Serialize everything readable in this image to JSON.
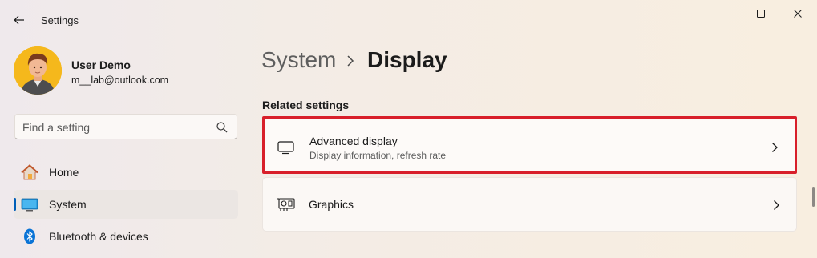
{
  "window": {
    "title": "Settings",
    "controls": {
      "minimize": "minimize-icon",
      "maximize": "maximize-icon",
      "close": "close-icon"
    }
  },
  "profile": {
    "name": "User Demo",
    "email": "m__lab@outlook.com"
  },
  "search": {
    "placeholder": "Find a setting"
  },
  "sidebar": {
    "items": [
      {
        "label": "Home",
        "icon": "home-icon",
        "active": false
      },
      {
        "label": "System",
        "icon": "system-icon",
        "active": true
      },
      {
        "label": "Bluetooth & devices",
        "icon": "bluetooth-icon",
        "active": false
      }
    ]
  },
  "header": {
    "parent": "System",
    "current": "Display"
  },
  "main": {
    "section_title": "Related settings",
    "cards": [
      {
        "title": "Advanced display",
        "subtitle": "Display information, refresh rate",
        "icon": "monitor-icon",
        "highlighted": true
      },
      {
        "title": "Graphics",
        "subtitle": "",
        "icon": "graphics-card-icon",
        "highlighted": false
      }
    ]
  },
  "colors": {
    "accent": "#005fb8",
    "highlight_border": "#d81f2a"
  }
}
